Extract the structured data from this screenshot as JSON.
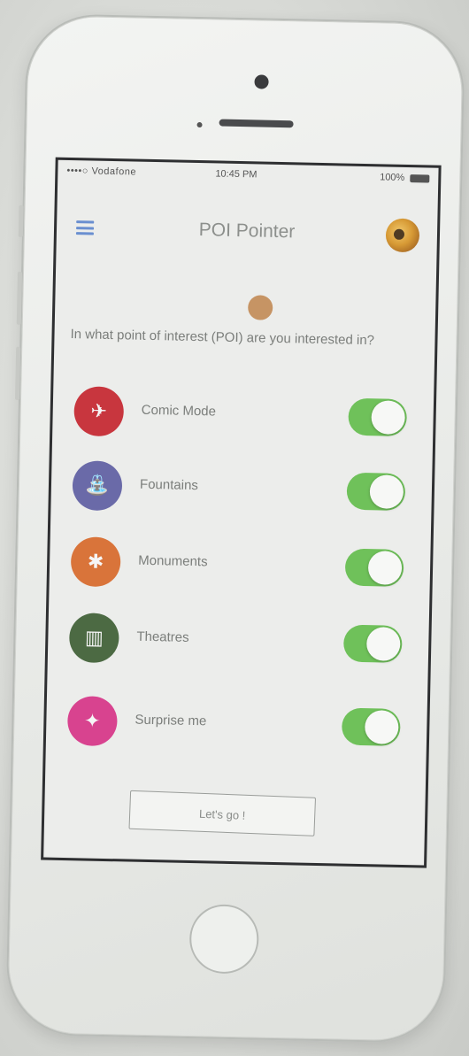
{
  "status_bar": {
    "carrier": "••••○ Vodafone",
    "time": "10:45 PM",
    "battery": "100%"
  },
  "header": {
    "menu_icon": "hamburger-icon",
    "title": "POI Pointer",
    "logo_icon": "poi-logo-icon"
  },
  "prompt": {
    "question": "In what point of interest (POI) are you interested in?"
  },
  "poi_options": [
    {
      "label": "Comic Mode",
      "icon": "comic-icon",
      "color": "#c8363e",
      "enabled": true
    },
    {
      "label": "Fountains",
      "icon": "fountain-icon",
      "color": "#6a6aa8",
      "enabled": true
    },
    {
      "label": "Monuments",
      "icon": "monument-icon",
      "color": "#d9743a",
      "enabled": true
    },
    {
      "label": "Theatres",
      "icon": "theatre-icon",
      "color": "#4c6a43",
      "enabled": true
    },
    {
      "label": "Surprise me",
      "icon": "surprise-icon",
      "color": "#d8438f",
      "enabled": true
    }
  ],
  "actions": {
    "go_label": "Let's go !"
  },
  "colors": {
    "toggle_on": "#6fc15a",
    "menu_accent": "#6a8fd0"
  }
}
